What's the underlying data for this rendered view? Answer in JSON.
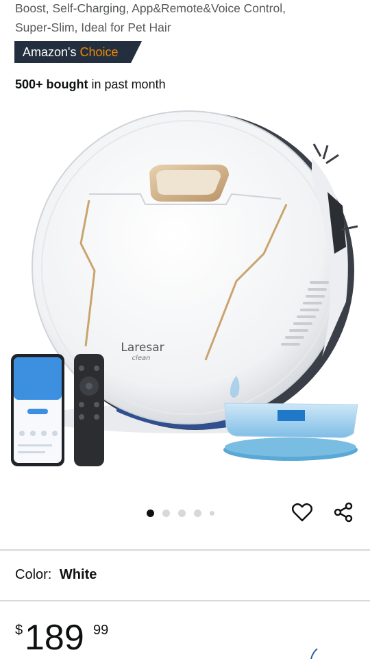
{
  "product": {
    "title_line_1": "Boost, Self-Charging, App&Remote&Voice Control,",
    "title_line_2": "Super-Slim, Ideal for Pet Hair",
    "badge_prefix": "Amazon's",
    "badge_choice": "Choice",
    "bought_bold": "500+ bought",
    "bought_rest": "in past month",
    "brand_on_device": "Laresar",
    "brand_sub": "clean"
  },
  "gallery": {
    "image_count": 5,
    "active_index": 0,
    "actions": [
      "heart-icon",
      "share-icon"
    ]
  },
  "variant": {
    "color_label": "Color:",
    "color_value": "White"
  },
  "price": {
    "symbol": "$",
    "whole": "189",
    "fraction": "99"
  },
  "colors": {
    "badge_bg": "#232f3e",
    "badge_choice": "#f08804",
    "gold": "#c9a46e",
    "divider": "#d5d9d9"
  }
}
